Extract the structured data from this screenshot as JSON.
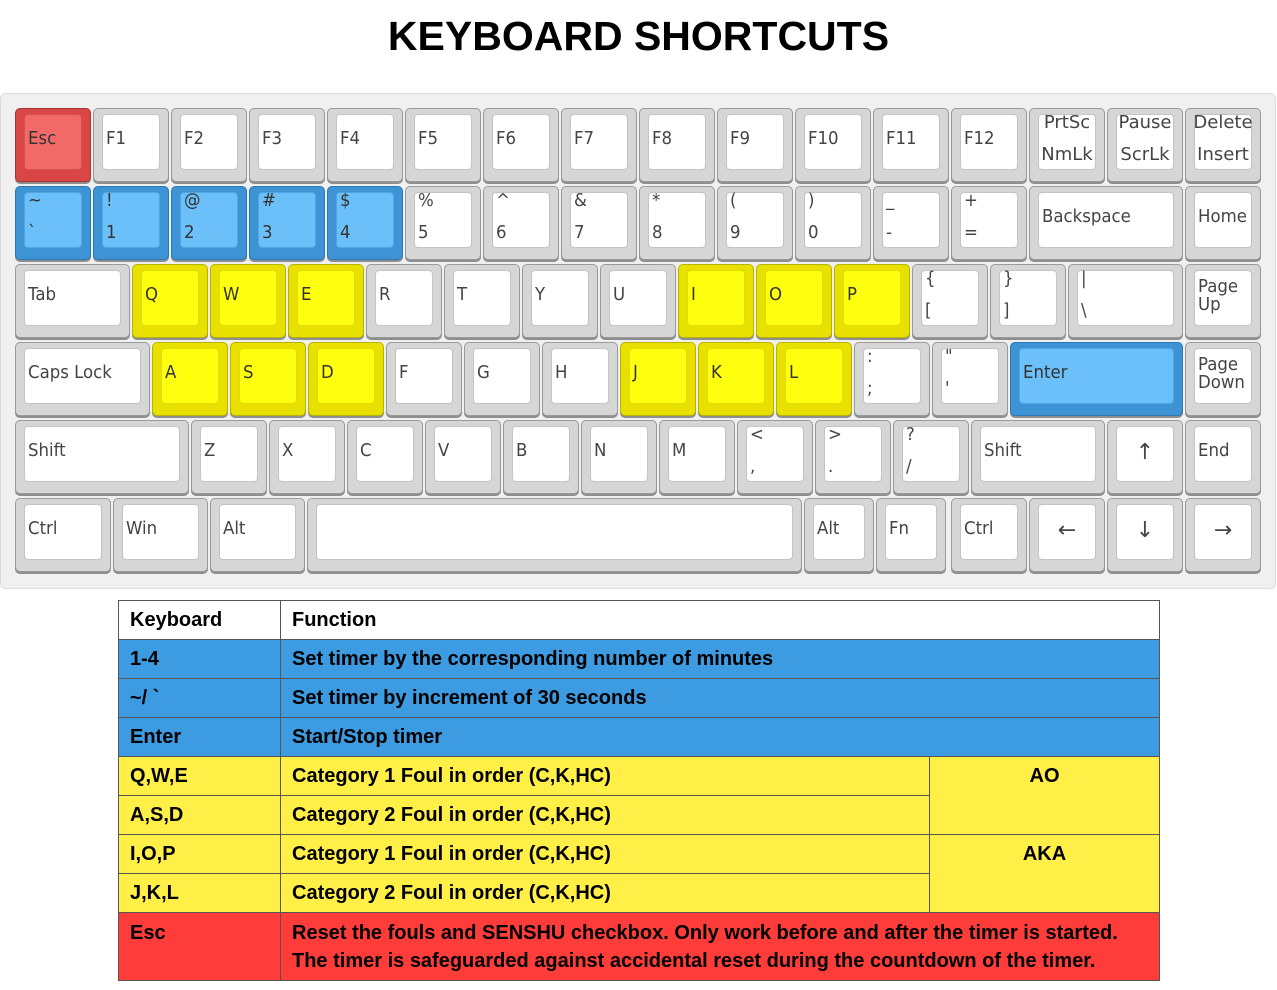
{
  "title": "KEYBOARD SHORTCUTS",
  "colors": {
    "highlight_blue": "#6cc0f9",
    "highlight_yellow": "#ffff10",
    "highlight_red": "#f26a68"
  },
  "keyboard": {
    "rows": [
      [
        {
          "labels": [
            "Esc"
          ],
          "color": "red"
        },
        {
          "labels": [
            "F1"
          ]
        },
        {
          "labels": [
            "F2"
          ]
        },
        {
          "labels": [
            "F3"
          ]
        },
        {
          "labels": [
            "F4"
          ]
        },
        {
          "labels": [
            "F5"
          ]
        },
        {
          "labels": [
            "F6"
          ]
        },
        {
          "labels": [
            "F7"
          ]
        },
        {
          "labels": [
            "F8"
          ]
        },
        {
          "labels": [
            "F9"
          ]
        },
        {
          "labels": [
            "F10"
          ]
        },
        {
          "labels": [
            "F11"
          ]
        },
        {
          "labels": [
            "F12"
          ]
        },
        {
          "labels": [
            "PrtSc",
            "NmLk"
          ]
        },
        {
          "labels": [
            "Pause",
            "ScrLk"
          ]
        },
        {
          "labels": [
            "Delete",
            "Insert"
          ]
        }
      ],
      [
        {
          "labels": [
            "~",
            "`"
          ],
          "color": "blue"
        },
        {
          "labels": [
            "!",
            "1"
          ],
          "color": "blue"
        },
        {
          "labels": [
            "@",
            "2"
          ],
          "color": "blue"
        },
        {
          "labels": [
            "#",
            "3"
          ],
          "color": "blue"
        },
        {
          "labels": [
            "$",
            "4"
          ],
          "color": "blue"
        },
        {
          "labels": [
            "%",
            "5"
          ]
        },
        {
          "labels": [
            "^",
            "6"
          ]
        },
        {
          "labels": [
            "&",
            "7"
          ]
        },
        {
          "labels": [
            "*",
            "8"
          ]
        },
        {
          "labels": [
            "(",
            "9"
          ]
        },
        {
          "labels": [
            ")",
            "0"
          ]
        },
        {
          "labels": [
            "_",
            "-"
          ]
        },
        {
          "labels": [
            "+",
            "="
          ]
        },
        {
          "labels": [
            "Backspace"
          ]
        },
        {
          "labels": [
            "Home"
          ]
        }
      ],
      [
        {
          "labels": [
            "Tab"
          ]
        },
        {
          "labels": [
            "Q"
          ],
          "color": "yellow"
        },
        {
          "labels": [
            "W"
          ],
          "color": "yellow"
        },
        {
          "labels": [
            "E"
          ],
          "color": "yellow"
        },
        {
          "labels": [
            "R"
          ]
        },
        {
          "labels": [
            "T"
          ]
        },
        {
          "labels": [
            "Y"
          ]
        },
        {
          "labels": [
            "U"
          ]
        },
        {
          "labels": [
            "I"
          ],
          "color": "yellow"
        },
        {
          "labels": [
            "O"
          ],
          "color": "yellow"
        },
        {
          "labels": [
            "P"
          ],
          "color": "yellow"
        },
        {
          "labels": [
            "{",
            "["
          ]
        },
        {
          "labels": [
            "}",
            "]"
          ]
        },
        {
          "labels": [
            "|",
            "\\"
          ]
        },
        {
          "labels": [
            "Page",
            "Up"
          ]
        }
      ],
      [
        {
          "labels": [
            "Caps Lock"
          ]
        },
        {
          "labels": [
            "A"
          ],
          "color": "yellow"
        },
        {
          "labels": [
            "S"
          ],
          "color": "yellow"
        },
        {
          "labels": [
            "D"
          ],
          "color": "yellow"
        },
        {
          "labels": [
            "F"
          ]
        },
        {
          "labels": [
            "G"
          ]
        },
        {
          "labels": [
            "H"
          ]
        },
        {
          "labels": [
            "J"
          ],
          "color": "yellow"
        },
        {
          "labels": [
            "K"
          ],
          "color": "yellow"
        },
        {
          "labels": [
            "L"
          ],
          "color": "yellow"
        },
        {
          "labels": [
            ":",
            ";"
          ]
        },
        {
          "labels": [
            "\"",
            "'"
          ]
        },
        {
          "labels": [
            "Enter"
          ],
          "color": "blue"
        },
        {
          "labels": [
            "Page",
            "Down"
          ]
        }
      ],
      [
        {
          "labels": [
            "Shift"
          ]
        },
        {
          "labels": [
            "Z"
          ]
        },
        {
          "labels": [
            "X"
          ]
        },
        {
          "labels": [
            "C"
          ]
        },
        {
          "labels": [
            "V"
          ]
        },
        {
          "labels": [
            "B"
          ]
        },
        {
          "labels": [
            "N"
          ]
        },
        {
          "labels": [
            "M"
          ]
        },
        {
          "labels": [
            "<",
            ","
          ]
        },
        {
          "labels": [
            ">",
            "."
          ]
        },
        {
          "labels": [
            "?",
            "/"
          ]
        },
        {
          "labels": [
            "Shift"
          ]
        },
        {
          "labels": [
            "↑"
          ]
        },
        {
          "labels": [
            "End"
          ]
        }
      ],
      [
        {
          "labels": [
            "Ctrl"
          ]
        },
        {
          "labels": [
            "Win"
          ]
        },
        {
          "labels": [
            "Alt"
          ]
        },
        {
          "labels": [
            ""
          ]
        },
        {
          "labels": [
            "Alt"
          ]
        },
        {
          "labels": [
            "Fn"
          ]
        },
        {
          "labels": [
            "Ctrl"
          ]
        },
        {
          "labels": [
            "←"
          ]
        },
        {
          "labels": [
            "↓"
          ]
        },
        {
          "labels": [
            "→"
          ]
        }
      ]
    ]
  },
  "table": {
    "header": {
      "key": "Keyboard",
      "function": "Function"
    },
    "rows": [
      {
        "key": "1-4",
        "function": "Set timer by the corresponding number of minutes",
        "color": "blue"
      },
      {
        "key": "~/ `",
        "function": "Set timer by increment of 30 seconds",
        "color": "blue"
      },
      {
        "key": "Enter",
        "function": "Start/Stop timer",
        "color": "blue"
      },
      {
        "key": "Q,W,E",
        "function": "Category 1 Foul in order (C,K,HC)",
        "color": "yellow",
        "group": "AO"
      },
      {
        "key": "A,S,D",
        "function": "Category 2 Foul in order (C,K,HC)",
        "color": "yellow"
      },
      {
        "key": "I,O,P",
        "function": "Category 1 Foul in order (C,K,HC)",
        "color": "yellow",
        "group": "AKA"
      },
      {
        "key": "J,K,L",
        "function": "Category 2 Foul in order (C,K,HC)",
        "color": "yellow"
      },
      {
        "key": "Esc",
        "function_lines": [
          "Reset the fouls and SENSHU checkbox. Only work before and after the timer is started.",
          "The timer is safeguarded against accidental reset during the countdown of the timer."
        ],
        "color": "red"
      }
    ]
  }
}
